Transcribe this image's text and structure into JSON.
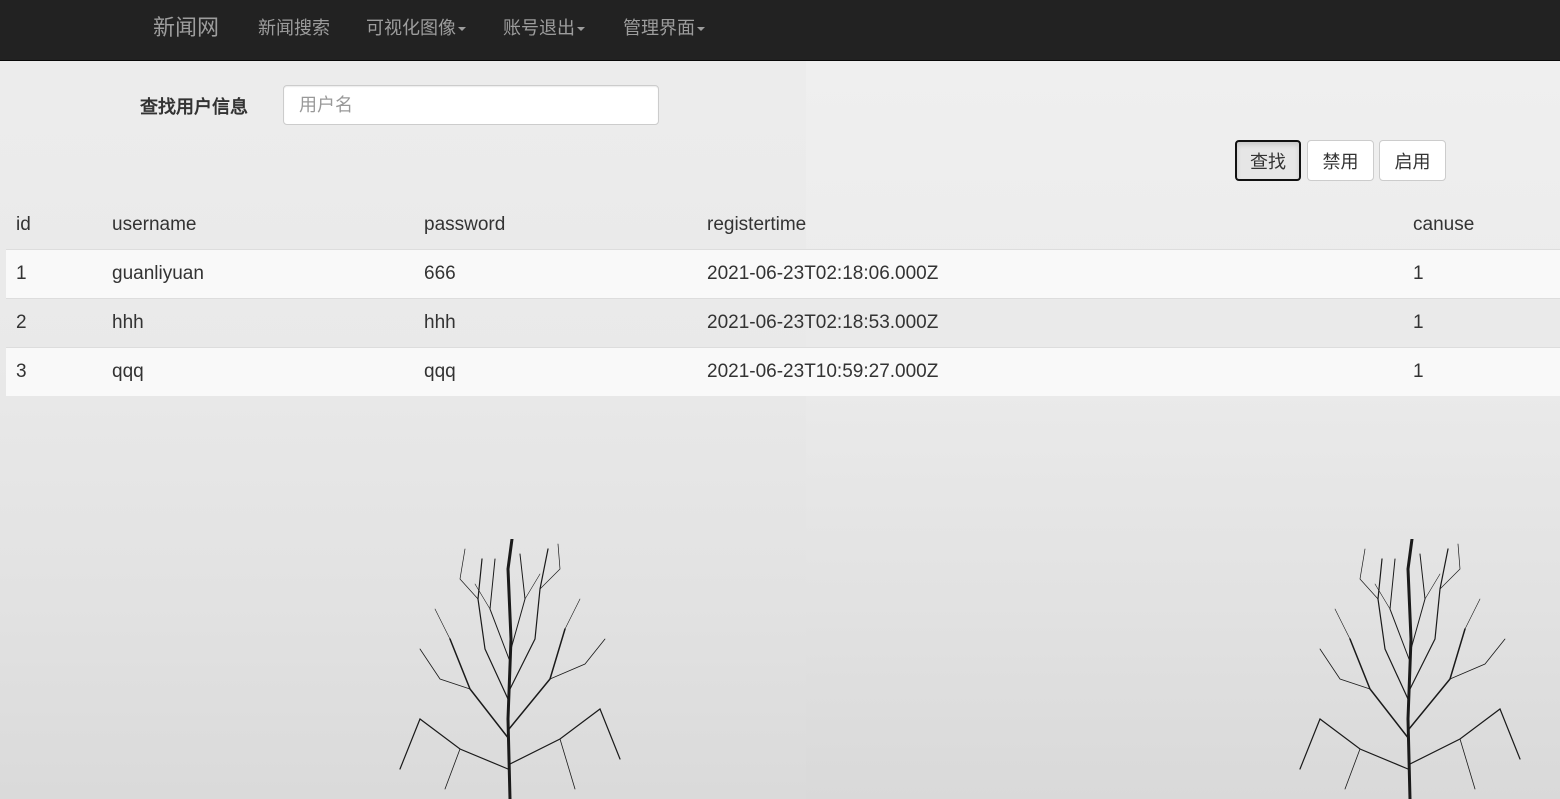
{
  "navbar": {
    "brand": "新闻网",
    "items": [
      {
        "label": "新闻搜索",
        "dropdown": false
      },
      {
        "label": "可视化图像",
        "dropdown": true
      },
      {
        "label": "账号退出",
        "dropdown": true
      },
      {
        "label": "管理界面",
        "dropdown": true
      }
    ]
  },
  "search": {
    "label": "查找用户信息",
    "placeholder": "用户名",
    "value": ""
  },
  "buttons": {
    "find": "查找",
    "disable": "禁用",
    "enable": "启用"
  },
  "table": {
    "columns": [
      "id",
      "username",
      "password",
      "registertime",
      "canuse"
    ],
    "rows": [
      [
        "1",
        "guanliyuan",
        "666",
        "2021-06-23T02:18:06.000Z",
        "1"
      ],
      [
        "2",
        "hhh",
        "hhh",
        "2021-06-23T02:18:53.000Z",
        "1"
      ],
      [
        "3",
        "qqq",
        "qqq",
        "2021-06-23T10:59:27.000Z",
        "1"
      ]
    ]
  },
  "colors": {
    "navbar_bg": "#222222",
    "nav_text": "#9d9d9d",
    "row_border": "#dddddd"
  }
}
